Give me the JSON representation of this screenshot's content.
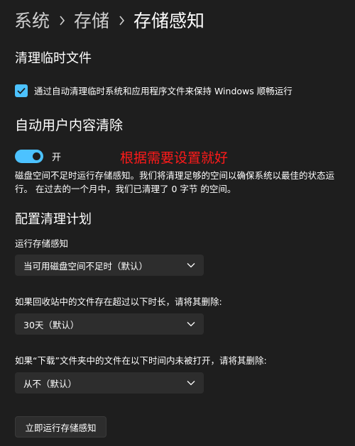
{
  "breadcrumb": {
    "items": [
      "系统",
      "存储",
      "存储感知"
    ],
    "separator_icon": "chevron-right-icon"
  },
  "cleanup_temp": {
    "title": "清理临时文件",
    "checkbox_label": "通过自动清理临时系统和应用程序文件来保持 Windows 顺畅运行",
    "checked": true
  },
  "auto_cleanup": {
    "title": "自动用户内容清除",
    "toggle_label": "开",
    "toggle_on": true,
    "description": "磁盘空间不足时运行存储感知。我们将清理足够的空间以确保系统以最佳的状态运行。 在过去的一个月中，我们已清理了 0 字节 的空间。"
  },
  "annotation": {
    "text": "根据需要设置就好",
    "color": "#ff1a1a"
  },
  "schedule": {
    "title": "配置清理计划",
    "run_label": "运行存储感知",
    "run_value": "当可用磁盘空间不足时（默认）",
    "recycle_label": "如果回收站中的文件存在超过以下时长，请将其删除:",
    "recycle_value": "30天（默认）",
    "downloads_label": "如果“下载”文件夹中的文件在以下时间内未被打开，请将其删除:",
    "downloads_value": "从不（默认）"
  },
  "run_now_button": "立即运行存储感知",
  "colors": {
    "background": "#1e1e1e",
    "accent": "#4cc2ff",
    "control": "#2d2d2d"
  }
}
